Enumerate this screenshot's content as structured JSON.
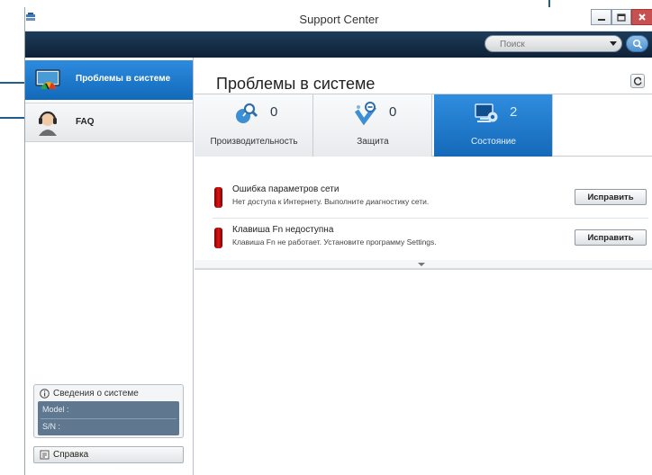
{
  "window": {
    "title": "Support Center"
  },
  "search": {
    "placeholder": "Поиск"
  },
  "sidebar": {
    "items": [
      {
        "label": "Проблемы в системе",
        "icon": "monitor-gauge-icon",
        "active": true
      },
      {
        "label": "FAQ",
        "icon": "headset-agent-icon",
        "active": false
      }
    ],
    "system_info": {
      "title": "Сведения о системе",
      "model_label": "Model :",
      "sn_label": "S/N :"
    },
    "help_label": "Справка"
  },
  "main": {
    "title": "Проблемы в системе",
    "tabs": [
      {
        "label": "Производительность",
        "count": "0",
        "icon": "performance-magnifier-icon"
      },
      {
        "label": "Защита",
        "count": "0",
        "icon": "security-shield-icon"
      },
      {
        "label": "Состояние",
        "count": "2",
        "icon": "status-settings-icon",
        "active": true
      }
    ],
    "issues": [
      {
        "title": "Ошибка параметров сети",
        "description": "Нет доступа к Интернету. Выполните диагностику сети.",
        "button": "Исправить"
      },
      {
        "title": "Клавиша Fn недоступна",
        "description": "Клавиша Fn не работает. Установите программу Settings.",
        "button": "Исправить"
      }
    ]
  },
  "colors": {
    "accent": "#1a76c8",
    "header": "#13273f",
    "issue": "#d01010"
  }
}
